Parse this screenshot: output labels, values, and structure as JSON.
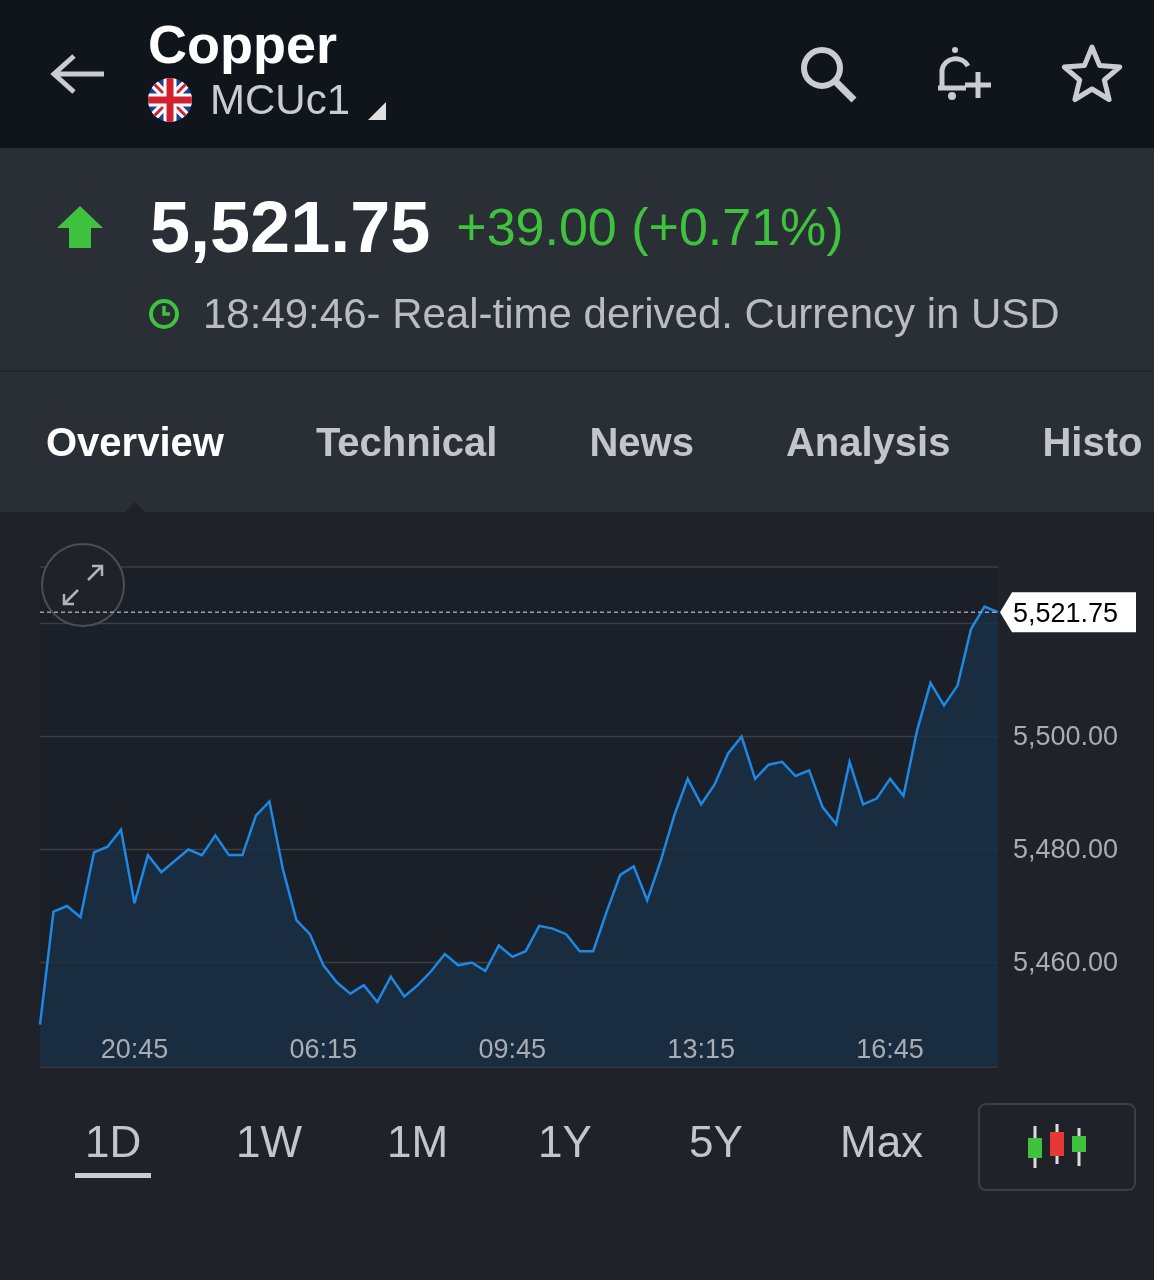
{
  "header": {
    "title": "Copper",
    "symbol": "MCUc1"
  },
  "quote": {
    "up": true,
    "price": "5,521.75",
    "change": "+39.00 (+0.71%)",
    "time_note": "18:49:46- Real-time derived. Currency in USD"
  },
  "tabs": [
    {
      "label": "Overview",
      "selected": true
    },
    {
      "label": "Technical",
      "selected": false
    },
    {
      "label": "News",
      "selected": false
    },
    {
      "label": "Analysis",
      "selected": false
    },
    {
      "label": "Histo",
      "selected": false
    }
  ],
  "chart": {
    "price_label": "5,521.75",
    "chart_data": {
      "type": "area",
      "values": [
        5449,
        5469,
        5470,
        5468,
        5479.5,
        5480.5,
        5483.5,
        5470.5,
        5479,
        5476,
        5478,
        5480,
        5479,
        5482.5,
        5479,
        5479,
        5486,
        5488.5,
        5476.5,
        5467.5,
        5465,
        5459.5,
        5456.5,
        5454.5,
        5456,
        5453,
        5457.5,
        5454,
        5456,
        5458.5,
        5461.5,
        5459.5,
        5460,
        5458.5,
        5463,
        5461,
        5462,
        5466.5,
        5466,
        5465,
        5462,
        5462,
        5469,
        5475.5,
        5477,
        5471,
        5478,
        5486,
        5492.5,
        5488,
        5491.5,
        5497,
        5500,
        5492.5,
        5495,
        5495.5,
        5493,
        5494,
        5487.5,
        5484.5,
        5495.5,
        5488,
        5489,
        5492.5,
        5489.5,
        5501,
        5509.5,
        5505.5,
        5509,
        5519,
        5523,
        5522
      ],
      "grid": true,
      "yticks": [
        {
          "value": 5460,
          "label": "5,460.00"
        },
        {
          "value": 5480,
          "label": "5,480.00"
        },
        {
          "value": 5500,
          "label": "5,500.00"
        }
      ],
      "ylim": [
        5441.5,
        5530
      ]
    },
    "time_labels": [
      "20:45",
      "06:15",
      "09:45",
      "13:15",
      "16:45"
    ]
  },
  "ranges": [
    {
      "label": "1D",
      "selected": true
    },
    {
      "label": "1W",
      "selected": false
    },
    {
      "label": "1M",
      "selected": false
    },
    {
      "label": "1Y",
      "selected": false
    },
    {
      "label": "5Y",
      "selected": false
    },
    {
      "label": "Max",
      "selected": false
    }
  ]
}
